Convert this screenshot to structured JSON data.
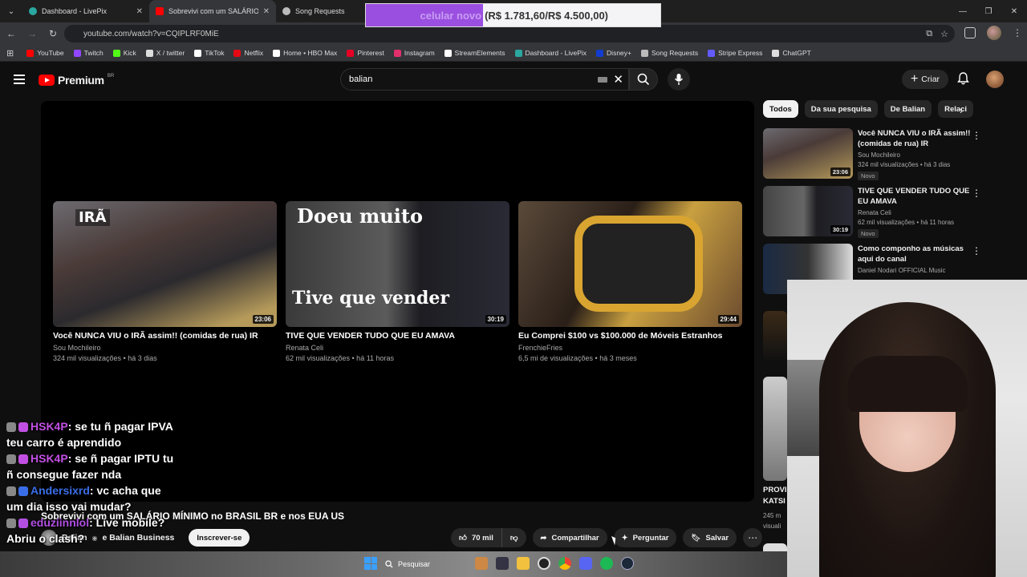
{
  "browser": {
    "tabs": [
      {
        "title": "Dashboard - LivePix",
        "color": "#2aa7a0"
      },
      {
        "title": "Sobrevivi com um SALÁRIO MÍ",
        "color": "#ff0000"
      },
      {
        "title": "Song Requests",
        "color": "#bbbbbb"
      }
    ],
    "url": "youtube.com/watch?v=CQIPLRF0MiE",
    "bookmarks": [
      {
        "label": "YouTube",
        "color": "#ff0000"
      },
      {
        "label": "Twitch",
        "color": "#9146ff"
      },
      {
        "label": "Kick",
        "color": "#53fc18"
      },
      {
        "label": "X / twitter",
        "color": "#dddddd"
      },
      {
        "label": "TikTok",
        "color": "#ffffff"
      },
      {
        "label": "Netflix",
        "color": "#e50914"
      },
      {
        "label": "Home • HBO Max",
        "color": "#ffffff"
      },
      {
        "label": "Pinterest",
        "color": "#e60023"
      },
      {
        "label": "Instagram",
        "color": "#e1306c"
      },
      {
        "label": "StreamElements",
        "color": "#ffffff"
      },
      {
        "label": "Dashboard - LivePix",
        "color": "#2aa7a0"
      },
      {
        "label": "Disney+",
        "color": "#113ccf"
      },
      {
        "label": "Song Requests",
        "color": "#bbbbbb"
      },
      {
        "label": "Stripe Express",
        "color": "#635bff"
      },
      {
        "label": "ChatGPT",
        "color": "#dddddd"
      }
    ]
  },
  "alert": {
    "label": "celular novo",
    "amount": "(R$ 1.781,60/R$ 4.500,00)",
    "progress_fraction": 0.3959
  },
  "youtube": {
    "logo_word": "Premium",
    "logo_country": "BR",
    "search_value": "balian",
    "create_label": "Criar"
  },
  "end_screen": [
    {
      "title": "Você NUNCA VIU o IRÃ assim!! (comidas de rua) IR",
      "channel": "Sou Mochileiro",
      "meta": "324 mil visualizações • há 3 dias",
      "duration": "23:06",
      "overlay": "IRÃ"
    },
    {
      "title": "TIVE QUE VENDER TUDO QUE EU AMAVA",
      "channel": "Renata Celi",
      "meta": "62 mil visualizações • há 11 horas",
      "duration": "30:19",
      "overlay": "Doeu muito",
      "overlay2": "Tive que vender"
    },
    {
      "title": "Eu Comprei $100 vs $100.000 de Móveis Estranhos",
      "channel": "FrenchieFries",
      "meta": "6,5 mi de visualizações • há 3 meses",
      "duration": "29:44"
    }
  ],
  "video": {
    "title": "Sobrevivi com um SALÁRIO MÍNIMO no BRASIL BR e nos EUA US",
    "channel": "Balian",
    "channel_and": "e Balian Business",
    "subscribe_label": "Inscrever-se",
    "likes": "70 mil",
    "share_label": "Compartilhar",
    "ask_label": "Perguntar",
    "save_label": "Salvar"
  },
  "chat": [
    {
      "user": "HSK4P",
      "user_color": "#c24fe3",
      "text": "se tu ñ pagar IPVA",
      "cont": "teu carro é aprendido"
    },
    {
      "user": "HSK4P",
      "user_color": "#c24fe3",
      "text": "se ñ pagar IPTU tu",
      "cont": "ñ consegue fazer nda"
    },
    {
      "user": "Andersixrd",
      "user_color": "#3a6ee8",
      "text": "vc acha que",
      "cont": "um dia isso vai mudar?"
    },
    {
      "user": "eduziinnlol",
      "user_color": "#b14fe3",
      "text": "Live mobile?",
      "cont": "Abriu o clash?"
    }
  ],
  "sidebar": {
    "chips": [
      "Todos",
      "Da sua pesquisa",
      "De Balian",
      "Relaci"
    ],
    "related": [
      {
        "title": "Você NUNCA VIU o IRÃ assim!! (comidas de rua) IR",
        "channel": "Sou Mochileiro",
        "meta": "324 mil visualizações • há 3 dias",
        "duration": "23:06",
        "badge": "Novo"
      },
      {
        "title": "TIVE QUE VENDER TUDO QUE EU AMAVA",
        "channel": "Renata Celi",
        "meta": "62 mil visualizações • há 11 horas",
        "duration": "30:19",
        "badge": "Novo"
      },
      {
        "title": "Como componho as músicas aqui do canal",
        "channel": "Daniel Nodari OFFICIAL Music",
        "meta": "",
        "duration": ""
      }
    ],
    "partial_title": "PROVI",
    "partial_title2": "KATSI",
    "partial_meta": "245 m",
    "partial_meta2": "visuali"
  },
  "taskbar": {
    "search_label": "Pesquisar"
  }
}
